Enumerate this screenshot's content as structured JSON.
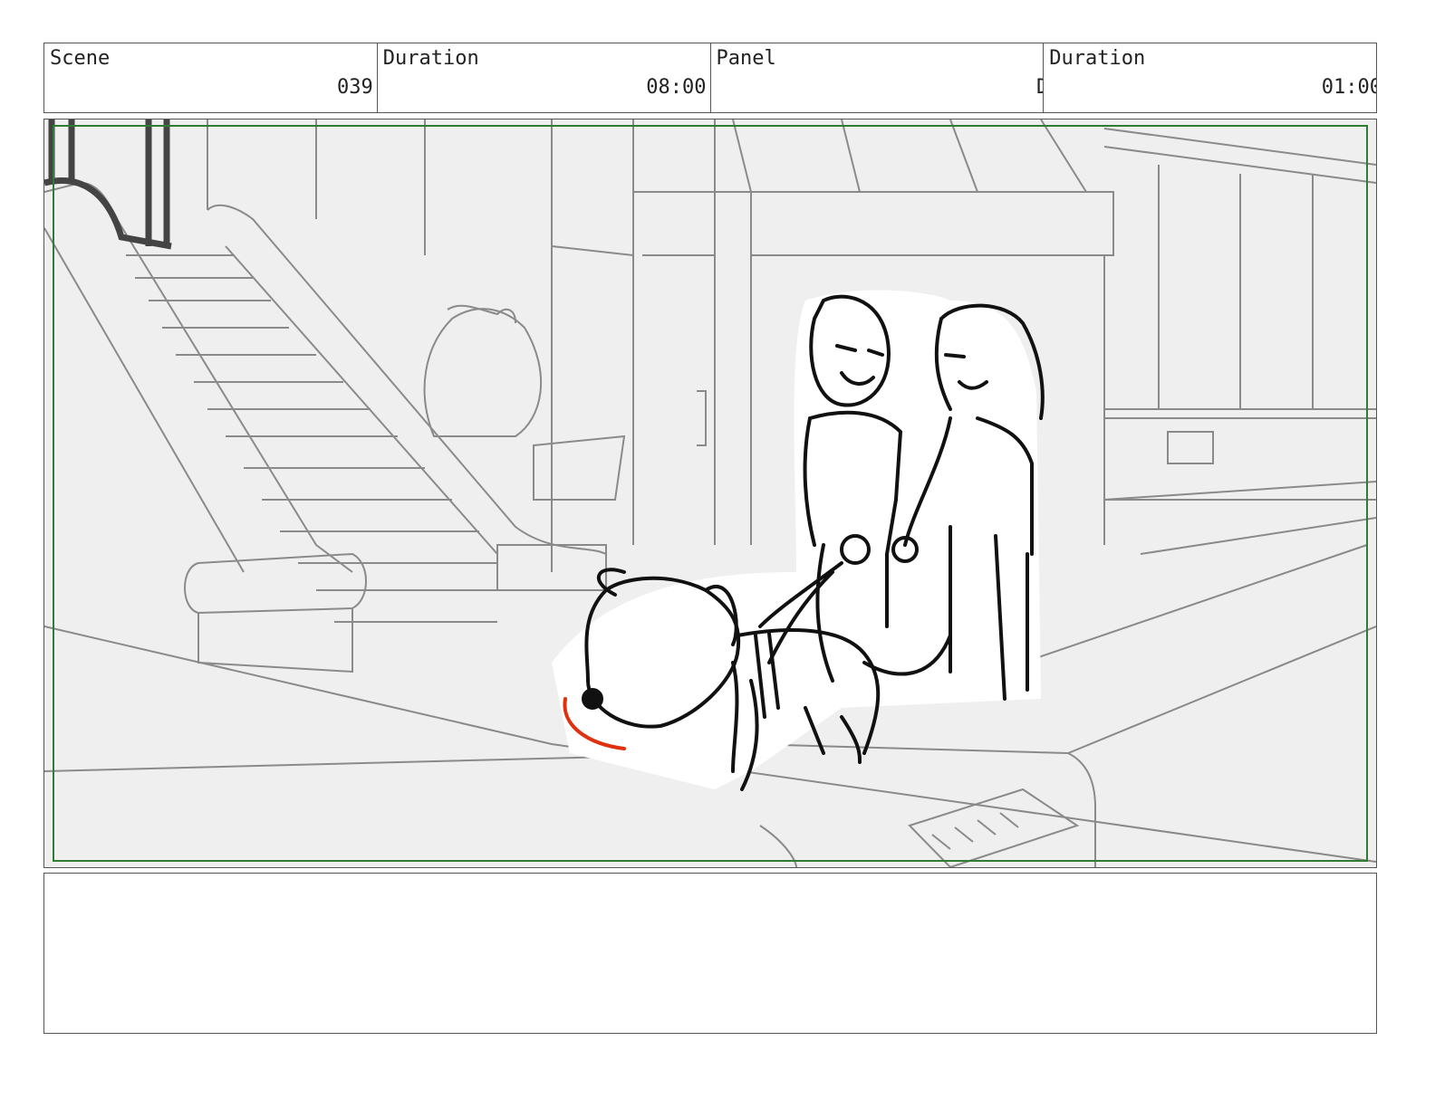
{
  "header": {
    "scene_label": "Scene",
    "scene_value": "039",
    "scene_duration_label": "Duration",
    "scene_duration_value": "08:00",
    "panel_label": "Panel",
    "panel_value": "D",
    "panel_duration_label": "Duration",
    "panel_duration_value": "01:00"
  },
  "notes": {
    "text": ""
  },
  "colors": {
    "frame_border": "#2e7d32",
    "motion_mark": "#e03010",
    "background_lines": "#888888",
    "ink": "#111111"
  }
}
